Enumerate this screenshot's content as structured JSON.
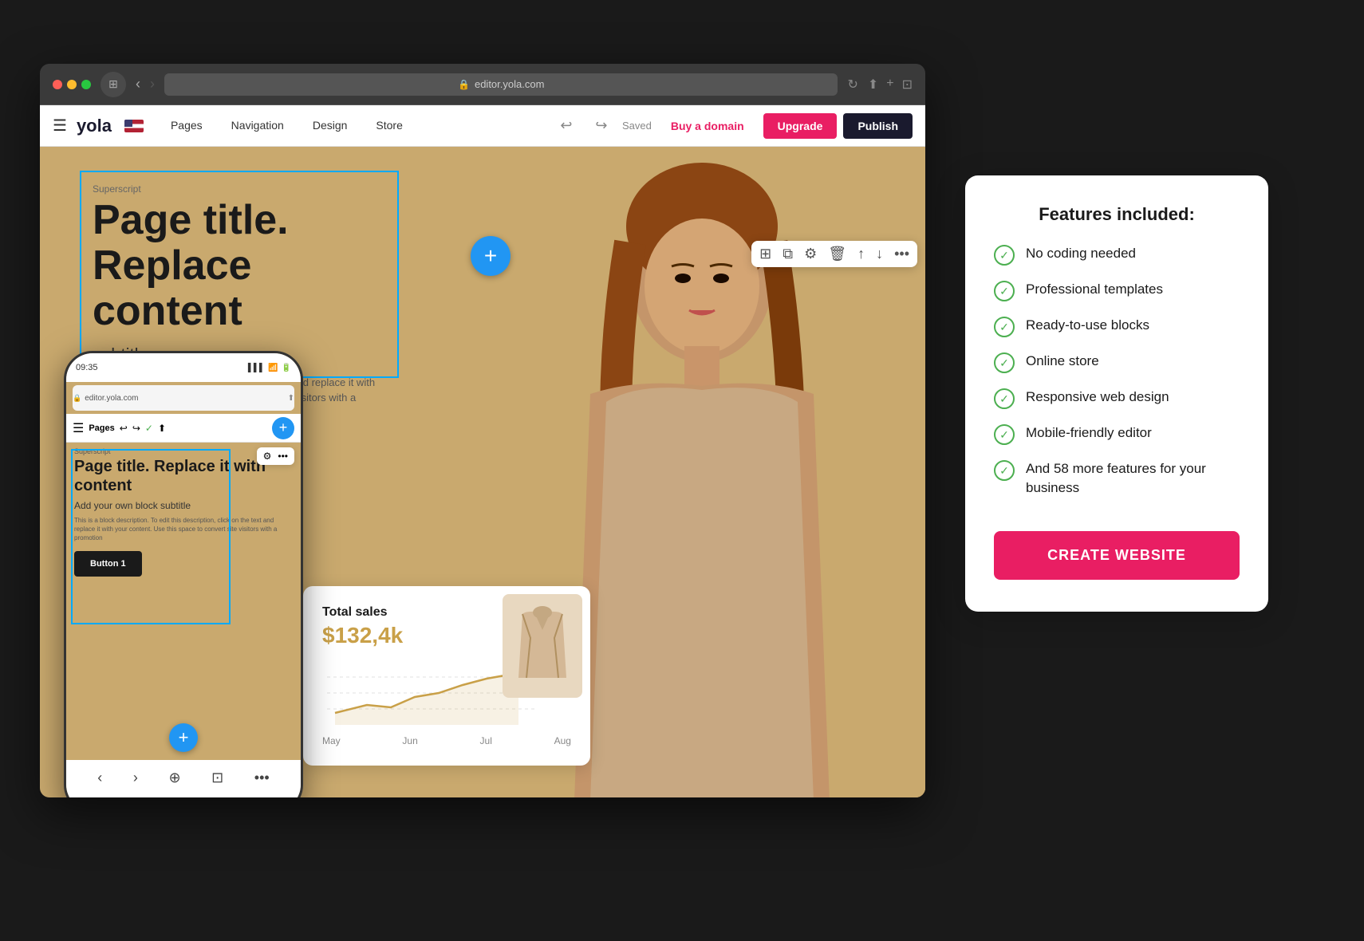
{
  "browser": {
    "url": "editor.yola.com",
    "shield_icon": "🛡",
    "back_arrow": "‹",
    "forward_arrow": "›"
  },
  "toolbar": {
    "menu_icon": "☰",
    "logo": "yola",
    "nav_items": [
      {
        "label": "Pages"
      },
      {
        "label": "Navigation"
      },
      {
        "label": "Design"
      },
      {
        "label": "Store"
      }
    ],
    "saved_label": "Saved",
    "buy_domain_label": "Buy a domain",
    "upgrade_label": "Upgrade",
    "publish_label": "Publish"
  },
  "floating_toolbar": {
    "icons": [
      "image",
      "copy",
      "settings",
      "trash",
      "up",
      "down",
      "more"
    ]
  },
  "hero": {
    "superscript": "Superscript",
    "title": "Page title. Replace\ncontent",
    "subtitle": "subtitle",
    "description": "This is a block description. click on the text and replace it with your content. Use this space to convert site visitors with a promotion"
  },
  "add_button_label": "+",
  "sales_card": {
    "title": "Total sales",
    "amount": "$132,4k",
    "months": [
      "May",
      "Jun",
      "Jul",
      "Aug"
    ]
  },
  "phone": {
    "time": "09:35",
    "url": "editor.yola.com",
    "pages_label": "Pages",
    "superscript": "Superscript",
    "title": "Page title. Replace it with content",
    "subtitle": "Add your own block subtitle",
    "description": "This is a block description. To edit this description, click on the text and replace it with your content. Use this space to convert site visitors with a promotion",
    "button_label": "Button 1",
    "add_btn": "+"
  },
  "features": {
    "title": "Features included:",
    "items": [
      {
        "text": "No coding needed"
      },
      {
        "text": "Professional templates"
      },
      {
        "text": "Ready-to-use blocks"
      },
      {
        "text": "Online store"
      },
      {
        "text": "Responsive web design"
      },
      {
        "text": "Mobile-friendly editor"
      },
      {
        "text": "And 58 more features for your business"
      }
    ],
    "cta_label": "CREATE WEBSITE"
  }
}
